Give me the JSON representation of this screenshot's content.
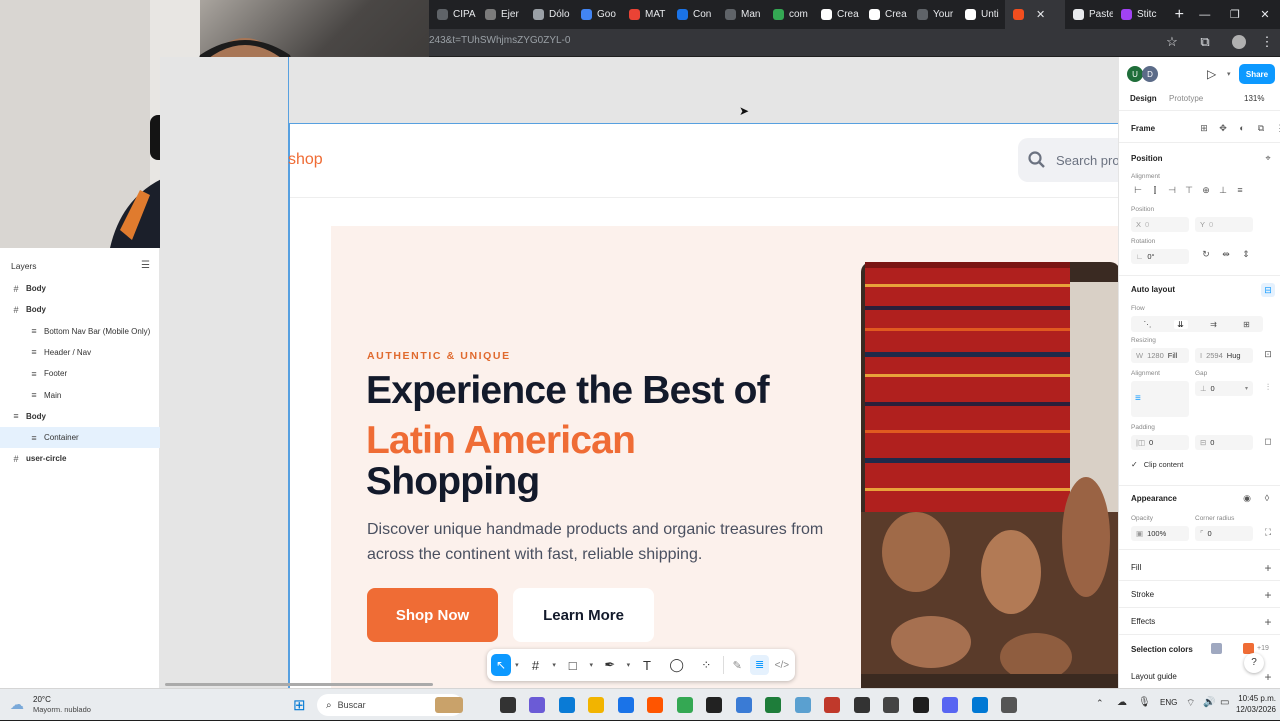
{
  "browser": {
    "tabs": [
      {
        "label": "CIPA",
        "color": "#5f6368"
      },
      {
        "label": "Ejer",
        "color": "#7b7b7b"
      },
      {
        "label": "Dólo",
        "color": "#9aa0a6"
      },
      {
        "label": "Goo",
        "color": "#4285f4"
      },
      {
        "label": "MAT",
        "color": "#ea4335"
      },
      {
        "label": "Con",
        "color": "#1a73e8"
      },
      {
        "label": "Man",
        "color": "#5f6368"
      },
      {
        "label": "com",
        "color": "#34a853"
      },
      {
        "label": "Crea",
        "color": "#ffffff"
      },
      {
        "label": "Crea",
        "color": "#ffffff"
      },
      {
        "label": "Your",
        "color": "#5f6368"
      },
      {
        "label": "Unti",
        "color": "#ffffff"
      },
      {
        "label": "",
        "color": "#f24e1e",
        "active": true
      },
      {
        "label": "Paste",
        "color": "#e8eaed"
      },
      {
        "label": "Stitc",
        "color": "#a142f4"
      }
    ],
    "new_tab": "+",
    "minimize": "—",
    "maximize": "❐",
    "close": "✕",
    "url": "243&t=TUhSWhjmsZYG0ZYL-0"
  },
  "figma": {
    "layers_title": "Layers",
    "layers": [
      {
        "label": "Body",
        "indent": 0,
        "type": "frame",
        "bold": true
      },
      {
        "label": "Body",
        "indent": 0,
        "type": "frame",
        "bold": true
      },
      {
        "label": "Bottom Nav Bar (Mobile Only)",
        "indent": 1,
        "type": "text"
      },
      {
        "label": "Header / Nav",
        "indent": 1,
        "type": "text"
      },
      {
        "label": "Footer",
        "indent": 1,
        "type": "text"
      },
      {
        "label": "Main",
        "indent": 1,
        "type": "text"
      },
      {
        "label": "Body",
        "indent": 0,
        "type": "text",
        "bold": true
      },
      {
        "label": "Container",
        "indent": 1,
        "type": "text",
        "selected": true
      },
      {
        "label": "user-circle",
        "indent": 0,
        "type": "frame",
        "bold": true
      }
    ],
    "right": {
      "avatars": [
        "U",
        "D"
      ],
      "share": "Share",
      "tab_design": "Design",
      "tab_prototype": "Prototype",
      "zoom": "131%",
      "frame_label": "Frame",
      "position_title": "Position",
      "alignment_label": "Alignment",
      "position_label": "Position",
      "x_label": "X",
      "x_value": "0",
      "y_label": "Y",
      "y_value": "0",
      "rotation_label": "Rotation",
      "rotation_value": "0°",
      "autolayout_title": "Auto layout",
      "flow_label": "Flow",
      "resizing_label": "Resizing",
      "w_label": "W",
      "w_value": "1280",
      "w_mode": "Fill",
      "h_value": "2594",
      "h_mode": "Hug",
      "al_alignment_label": "Alignment",
      "gap_label": "Gap",
      "gap_value": "0",
      "padding_label": "Padding",
      "pad_h": "0",
      "pad_v": "0",
      "clip_label": "Clip content",
      "appearance_title": "Appearance",
      "opacity_label": "Opacity",
      "opacity_value": "100%",
      "radius_label": "Corner radius",
      "radius_value": "0",
      "fill_title": "Fill",
      "stroke_title": "Stroke",
      "effects_title": "Effects",
      "selcolors_title": "Selection colors",
      "selcolors_more": "+19",
      "layoutguide_title": "Layout guide",
      "help": "?"
    }
  },
  "site": {
    "logo_partial": "shop",
    "search_placeholder": "Search prod",
    "eyebrow": "AUTHENTIC & UNIQUE",
    "title_line1": "Experience the Best of",
    "title_line2": "Latin American",
    "title_line3": "Shopping",
    "subtitle": "Discover unique handmade products and organic treasures from across the continent with fast, reliable shipping.",
    "btn_primary": "Shop Now",
    "btn_secondary": "Learn More",
    "accent": "#ef6c35"
  },
  "taskbar": {
    "temp": "20°C",
    "weather": "Mayorm. nublado",
    "search": "Buscar",
    "lang": "ENG",
    "time": "10:45 p.m.",
    "date": "12/03/2026"
  }
}
